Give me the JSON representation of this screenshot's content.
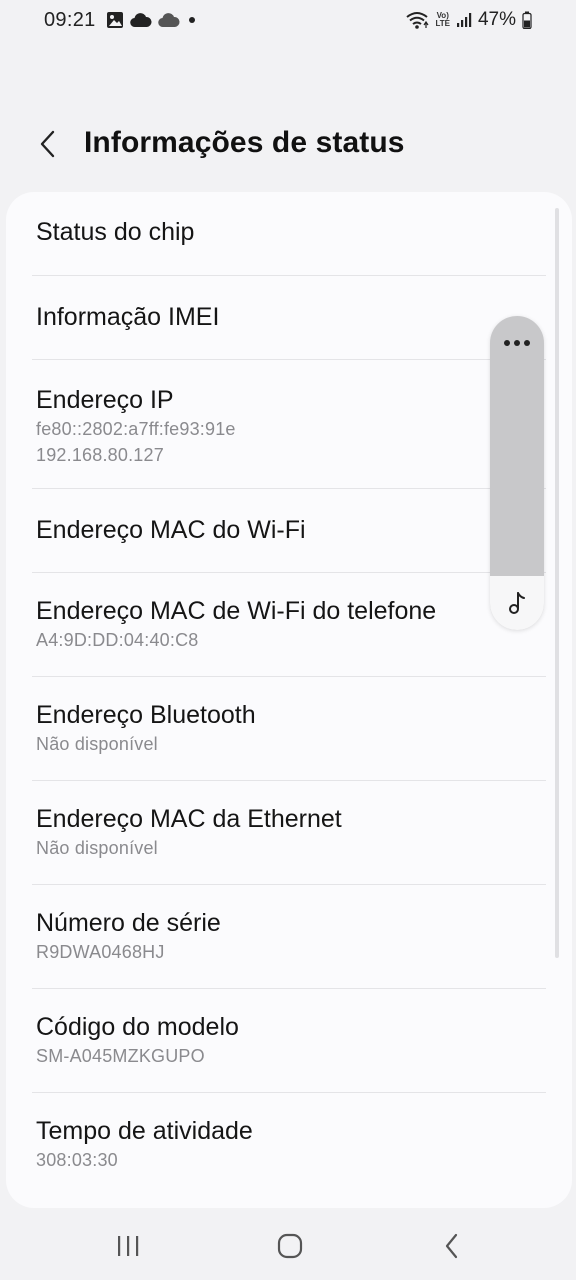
{
  "status_bar": {
    "time": "09:21",
    "left_icons": [
      "image-icon",
      "cloud-icon",
      "cloud-icon",
      "dot-icon"
    ],
    "volte_line1": "Vo)",
    "volte_line2": "LTE",
    "battery_percent": "47%"
  },
  "header": {
    "title": "Informações de status"
  },
  "items": [
    {
      "title": "Status do chip",
      "values": []
    },
    {
      "title": "Informação IMEI",
      "values": []
    },
    {
      "title": "Endereço IP",
      "values": [
        "fe80::2802:a7ff:fe93:91e",
        "192.168.80.127"
      ]
    },
    {
      "title": "Endereço MAC do Wi-Fi",
      "values": []
    },
    {
      "title": "Endereço MAC de Wi-Fi do telefone",
      "values": [
        "A4:9D:DD:04:40:C8"
      ]
    },
    {
      "title": "Endereço Bluetooth",
      "values": [
        "Não disponível"
      ]
    },
    {
      "title": "Endereço MAC da Ethernet",
      "values": [
        "Não disponível"
      ]
    },
    {
      "title": "Número de série",
      "values": [
        "R9DWA0468HJ"
      ]
    },
    {
      "title": "Código do modelo",
      "values": [
        "SM-A045MZKGUPO"
      ]
    },
    {
      "title": "Tempo de atividade",
      "values": [
        "308:03:30"
      ]
    }
  ],
  "floating_panel": {
    "icons": [
      "more-icon",
      "music-note-icon"
    ]
  },
  "nav_bar": {
    "icons": [
      "recents-icon",
      "home-icon",
      "back-icon"
    ]
  }
}
